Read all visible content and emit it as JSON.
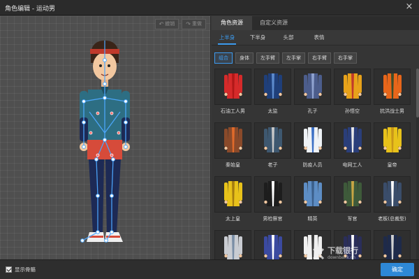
{
  "window": {
    "title": "角色编辑 - 运动男",
    "close_glyph": "×"
  },
  "canvas": {
    "undo_label": "撤销",
    "redo_label": "重做",
    "show_bones_label": "显示骨骼",
    "show_bones_checked": true
  },
  "panel": {
    "top_tabs": [
      {
        "label": "角色资源",
        "active": true
      },
      {
        "label": "自定义资源",
        "active": false
      }
    ],
    "sub_tabs": [
      {
        "label": "上半身",
        "active": true
      },
      {
        "label": "下半身",
        "active": false
      },
      {
        "label": "头部",
        "active": false
      },
      {
        "label": "表情",
        "active": false
      }
    ],
    "filters": [
      {
        "label": "组合",
        "active": true
      },
      {
        "label": "身体",
        "active": false
      },
      {
        "label": "左手臂",
        "active": false
      },
      {
        "label": "左手掌",
        "active": false
      },
      {
        "label": "右手臂",
        "active": false
      },
      {
        "label": "右手掌",
        "active": false
      }
    ],
    "items": [
      {
        "label": "石油工人男",
        "color": "#d62a2a",
        "accent": "#b01818"
      },
      {
        "label": "太监",
        "color": "#1f3f7a",
        "accent": "#5c8acb"
      },
      {
        "label": "孔子",
        "color": "#4c5d8c",
        "accent": "#8fa2cf"
      },
      {
        "label": "孙悟空",
        "color": "#e8a21a",
        "accent": "#c0392b"
      },
      {
        "label": "抗洪战士男",
        "color": "#e8661a",
        "accent": "#3d4d2a"
      },
      {
        "label": "秦始皇",
        "color": "#8a4a2a",
        "accent": "#e06a2a"
      },
      {
        "label": "老子",
        "color": "#3e5870",
        "accent": "#c7c7c7"
      },
      {
        "label": "防疫人员",
        "color": "#eef2f6",
        "accent": "#3b6fc4"
      },
      {
        "label": "电网工人",
        "color": "#2a3e7a",
        "accent": "#e8e8e8"
      },
      {
        "label": "皇帝",
        "color": "#e8c21a",
        "accent": "#c9961a"
      },
      {
        "label": "太上皇",
        "color": "#e8c21a",
        "accent": "#a57d10"
      },
      {
        "label": "男检察官",
        "color": "#1d1d1d",
        "accent": "#ffffff"
      },
      {
        "label": "精英",
        "color": "#5d8dc4",
        "accent": "#3b5f8a"
      },
      {
        "label": "军官",
        "color": "#3e5a3a",
        "accent": "#c7a545"
      },
      {
        "label": "老板(总裁型)",
        "color": "#3a4d6a",
        "accent": "#ffffff"
      },
      {
        "label": "",
        "color": "#c9ccd2",
        "accent": "#7a8ea6"
      },
      {
        "label": "",
        "color": "#3b4aa0",
        "accent": "#ffffff"
      },
      {
        "label": "",
        "color": "#f0f0f0",
        "accent": "#3a3a3a"
      },
      {
        "label": "",
        "color": "#2a2e5a",
        "accent": "#ffffff"
      },
      {
        "label": "",
        "color": "#1e2a4a",
        "accent": "#d0d0d0"
      }
    ],
    "confirm_label": "确定"
  },
  "watermark": {
    "main": "下载银行",
    "sub": "downbank.cn"
  },
  "colors": {
    "accent": "#3d9cf0",
    "confirm": "#2e88d6"
  }
}
